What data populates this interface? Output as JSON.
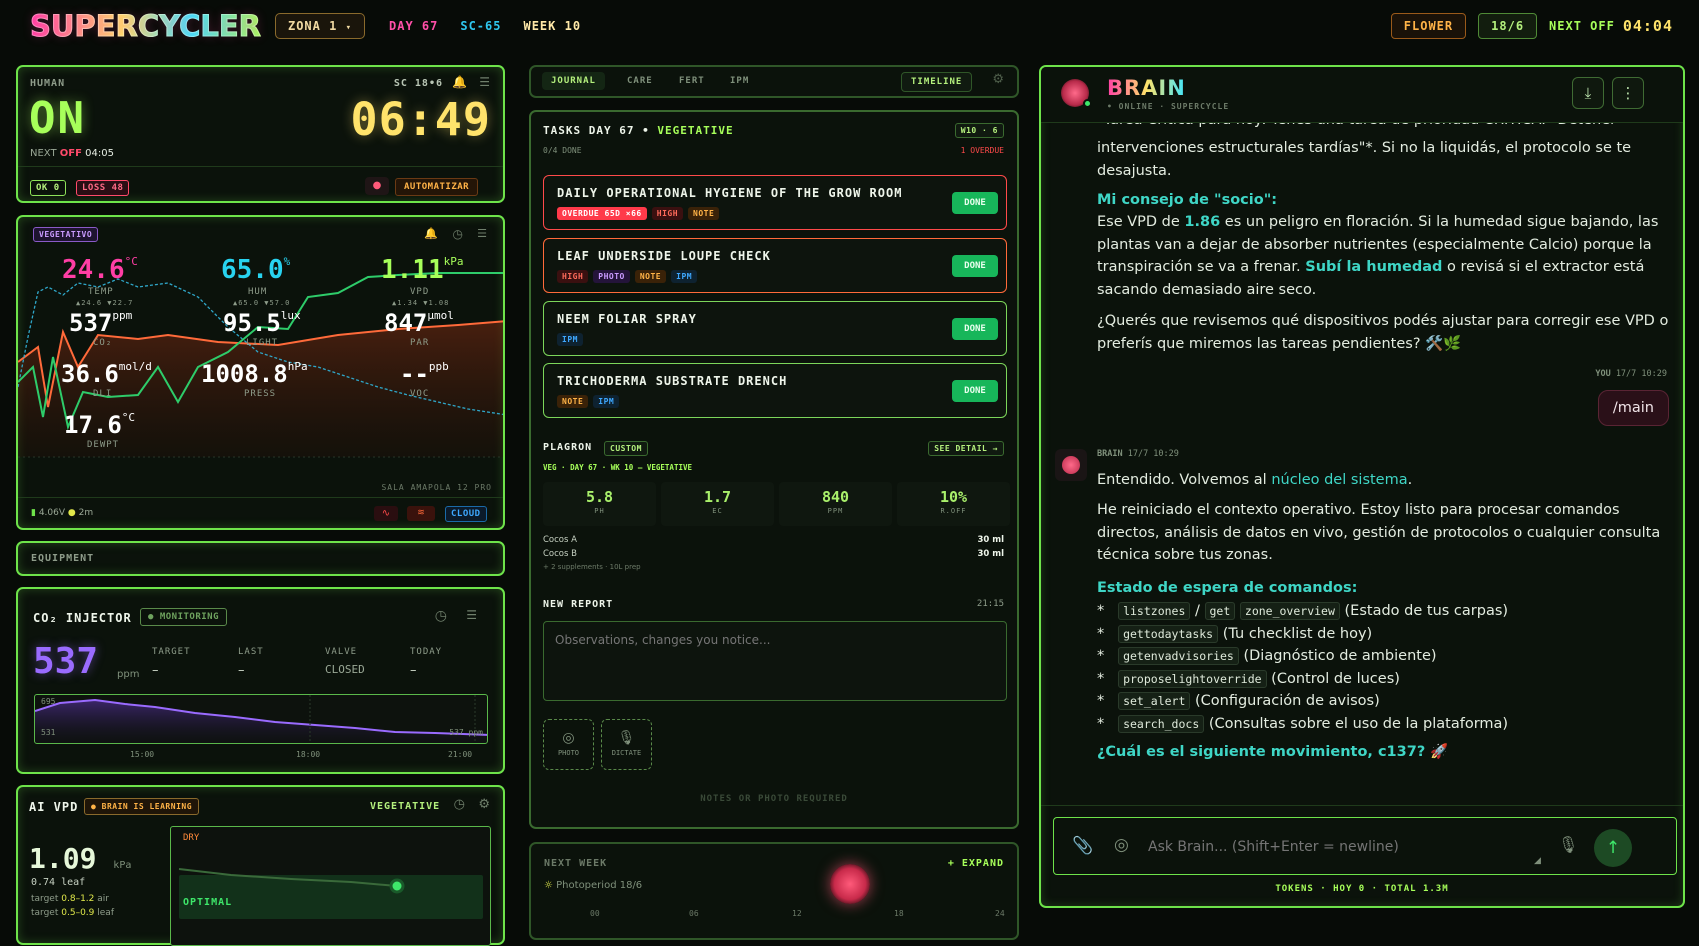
{
  "app": {
    "logo": "SUPERCYCLER",
    "zone": "ZONA 1",
    "day": "DAY 67",
    "strain": "SC-65",
    "week": "WEEK 10"
  },
  "top_right": {
    "stage": "FLOWER",
    "photoperiod": "18/6",
    "next_off_label": "NEXT OFF",
    "next_off_time": "04:04"
  },
  "human": {
    "label": "HUMAN",
    "sc": "SC 18•6",
    "state": "ON",
    "time": "06:49",
    "next_prefix": "NEXT",
    "next_off": "OFF",
    "next_time": "04:05",
    "ok_badge": "OK 0",
    "loss_badge": "LOSS 48",
    "automate": "AUTOMATIZAR"
  },
  "sensors": {
    "stage": "VEGETATIVO",
    "temp": {
      "value": "24.6",
      "unit": "°C",
      "label": "TEMP",
      "sub": "▲24.6 ▼22.7"
    },
    "hum": {
      "value": "65.0",
      "unit": "%",
      "label": "HUM",
      "sub": "▲65.0 ▼57.0"
    },
    "vpd": {
      "value": "1.11",
      "unit": "kPa",
      "label": "VPD",
      "sub": "▲1.34 ▼1.08"
    },
    "co2": {
      "value": "537",
      "unit": "ppm",
      "label": "CO₂"
    },
    "light": {
      "value": "95.5",
      "unit": "lux",
      "label": "LIGHT"
    },
    "par": {
      "value": "847",
      "unit": "µmol",
      "label": "PAR"
    },
    "dli": {
      "value": "36.6",
      "unit": "mol/d",
      "label": "DLI"
    },
    "press": {
      "value": "1008.8",
      "unit": "hPa",
      "label": "PRESS"
    },
    "voc": {
      "value": "--",
      "unit": "ppb",
      "label": "VOC"
    },
    "dewpt": {
      "value": "17.6",
      "unit": "°C",
      "label": "DEWPT"
    },
    "room": "SALA AMAPOLA 12 PRO",
    "battery": "4.06V",
    "age": "2m",
    "cloud": "CLOUD"
  },
  "equipment": {
    "label": "EQUIPMENT"
  },
  "co2_injector": {
    "title": "CO₂ INJECTOR",
    "status": "● MONITORING",
    "value": "537",
    "unit": "ppm",
    "target_label": "TARGET",
    "target": "–",
    "last_label": "LAST",
    "last": "–",
    "valve_label": "VALVE",
    "valve": "CLOSED",
    "today_label": "TODAY",
    "today": "–",
    "chart_top": "695",
    "chart_bottom": "531",
    "chart_end": "537 ppm",
    "ticks": [
      "15:00",
      "18:00",
      "21:00"
    ]
  },
  "ai_vpd": {
    "title": "AI VPD",
    "badge": "● BRAIN IS LEARNING",
    "stage": "VEGETATIVE",
    "value": "1.09",
    "unit": "kPa",
    "leaf": "0.74 leaf",
    "target_air_prefix": "target",
    "target_air": "0.8–1.2",
    "target_air_suffix": "air",
    "target_leaf_prefix": "target",
    "target_leaf": "0.5–0.9",
    "target_leaf_suffix": "leaf",
    "zone_dry": "DRY",
    "zone_optimal": "OPTIMAL"
  },
  "tabs": {
    "items": [
      "JOURNAL",
      "CARE",
      "FERT",
      "IPM"
    ],
    "timeline": "TIMELINE"
  },
  "tasks": {
    "title_prefix": "TASKS DAY 67 •",
    "title_stage": "VEGETATIVE",
    "week_badge": "W10 · 6",
    "done_count": "0/4 DONE",
    "overdue": "1 OVERDUE",
    "done_label": "DONE",
    "items": [
      {
        "title": "DAILY OPERATIONAL HYGIENE OF THE GROW ROOM",
        "tags": [
          "OVERDUE 65D ×66",
          "HIGH",
          "NOTE"
        ]
      },
      {
        "title": "LEAF UNDERSIDE LOUPE CHECK",
        "tags": [
          "HIGH",
          "PHOTO",
          "NOTE",
          "IPM"
        ]
      },
      {
        "title": "NEEM FOLIAR SPRAY",
        "tags": [
          "IPM"
        ]
      },
      {
        "title": "TRICHODERMA SUBSTRATE DRENCH",
        "tags": [
          "NOTE",
          "IPM"
        ]
      }
    ]
  },
  "plagron": {
    "title": "PLAGRON",
    "badge": "CUSTOM",
    "detail": "SEE DETAIL →",
    "sub": "VEG · DAY 67 · WK 10 — VEGETATIVE",
    "metrics": [
      {
        "v": "5.8",
        "l": "PH"
      },
      {
        "v": "1.7",
        "l": "EC"
      },
      {
        "v": "840",
        "l": "PPM"
      },
      {
        "v": "10%",
        "l": "R.OFF"
      }
    ],
    "lines": [
      {
        "name": "Cocos A",
        "amount": "30 ml"
      },
      {
        "name": "Cocos B",
        "amount": "30 ml"
      }
    ],
    "footnote": "+ 2 supplements · 10L prep"
  },
  "report": {
    "title": "NEW REPORT",
    "time": "21:15",
    "placeholder": "Observations, changes you notice...",
    "photo": "PHOTO",
    "dictate": "DICTATE",
    "required": "NOTES OR PHOTO REQUIRED"
  },
  "next_week": {
    "title": "NEXT WEEK",
    "expand": "+ EXPAND",
    "photoperiod": "Photoperiod 18/6",
    "ticks": [
      "00",
      "06",
      "12",
      "18",
      "24"
    ]
  },
  "chat": {
    "title": "BRAIN",
    "status": "• ONLINE · SUPERCYCLE",
    "partial_line": "\"Tarea Crítica para hoy: Tenés una tarea de prioridad CRÍTICA: \"Detener",
    "msg1_p1": "intervenciones estructurales tardías\"*. Si no la liquidás, el protocolo se te desajusta.",
    "advice_title": "Mi consejo de \"socio\":",
    "advice_a": "Ese VPD de ",
    "advice_vpd": "1.86",
    "advice_b": " es un peligro en floración. Si la humedad sigue bajando, las plantas van a dejar de absorber nutrientes (especialmente Calcio) porque la transpiración se va a frenar. ",
    "advice_cta": "Subí la humedad",
    "advice_c": " o revisá si el extractor está sacando demasiado aire seco.",
    "question": "¿Querés que revisemos qué dispositivos podés ajustar para corregir ese VPD o preferís que miremos las tareas pendientes? 🛠️🌿",
    "you_label": "YOU",
    "you_time": "17/7 10:29",
    "you_msg": "/main",
    "brain_label": "BRAIN",
    "brain_time": "17/7 10:29",
    "r1_a": "Entendido. Volvemos al ",
    "r1_link": "núcleo del sistema",
    "r1_b": ".",
    "r2": "He reiniciado el contexto operativo. Estoy listo para procesar comandos directos, análisis de datos en vivo, gestión de protocolos o cualquier consulta técnica sobre tus zonas.",
    "cmd_title": "Estado de espera de comandos:",
    "cmds": [
      {
        "c1": "listzones",
        "c2": "get",
        "c3": "zone_overview",
        "d": "(Estado de tus carpas)"
      },
      {
        "c1": "gettodaytasks",
        "d": "(Tu checklist de hoy)"
      },
      {
        "c1": "getenvadvisories",
        "d": "(Diagnóstico de ambiente)"
      },
      {
        "c1": "proposelightoverride",
        "d": "(Control de luces)"
      },
      {
        "c1": "set_alert",
        "d": "(Configuración de avisos)"
      },
      {
        "c1": "search_docs",
        "d": "(Consultas sobre el uso de la plataforma)"
      }
    ],
    "next_move": "¿Cuál es el siguiente movimiento, c137? 🚀",
    "input_placeholder": "Ask Brain... (Shift+Enter = newline)",
    "tokens": "TOKENS · HOY 0 · TOTAL 1.3M"
  },
  "colors": {
    "accent": "#6ee34a",
    "pink": "#ff3ea5",
    "cyan": "#28d3f0",
    "lime": "#a7ff5a",
    "yellow": "#ffe36b",
    "teal": "#3fd6c6"
  }
}
